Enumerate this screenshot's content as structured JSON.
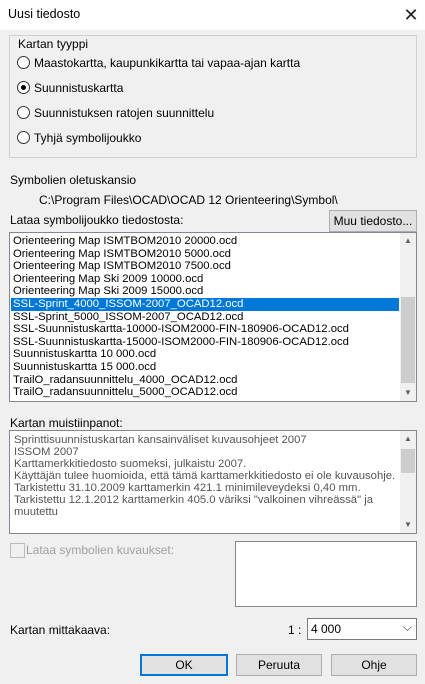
{
  "window": {
    "title": "Uusi tiedosto"
  },
  "map_type": {
    "legend": "Kartan tyyppi",
    "options": [
      {
        "label": "Maastokartta, kaupunkikartta tai vapaa-ajan kartta",
        "selected": false
      },
      {
        "label": "Suunnistuskartta",
        "selected": true
      },
      {
        "label": "Suunnistuksen ratojen suunnittelu",
        "selected": false
      },
      {
        "label": "Tyhjä symbolijoukko",
        "selected": false
      }
    ]
  },
  "symbol_folder": {
    "label": "Symbolien oletuskansio",
    "path": "C:\\Program Files\\OCAD\\OCAD 12 Orienteering\\Symbol\\"
  },
  "load_symbols": {
    "label": "Lataa symbolijoukko tiedostosta:",
    "other_file_button": "Muu tiedosto...",
    "items": [
      "Orienteering Map ISMTBOM2010 20000.ocd",
      "Orienteering Map ISMTBOM2010 5000.ocd",
      "Orienteering Map ISMTBOM2010 7500.ocd",
      "Orienteering Map Ski 2009 10000.ocd",
      "Orienteering Map Ski 2009 15000.ocd",
      "SSL-Sprint_4000_ISSOM-2007_OCAD12.ocd",
      "SSL-Sprint_5000_ISSOM-2007_OCAD12.ocd",
      "SSL-Suunnistuskartta-10000-ISOM2000-FIN-180906-OCAD12.ocd",
      "SSL-Suunnistuskartta-15000-ISOM2000-FIN-180906-OCAD12.ocd",
      "Suunnistuskartta 10 000.ocd",
      "Suunnistuskartta 15 000.ocd",
      "TrailO_radansuunnittelu_4000_OCAD12.ocd",
      "TrailO_radansuunnittelu_5000_OCAD12.ocd"
    ],
    "selected_index": 5
  },
  "notes": {
    "label": "Kartan muistiinpanot:",
    "lines": [
      "Sprinttisuunnistuskartan kansainväliset kuvausohjeet 2007",
      "ISSOM 2007",
      "Karttamerkkitiedosto suomeksi, julkaistu 2007.",
      "Käyttäjän tulee huomioida, että tämä karttamerkkitiedosto ei ole kuvausohje.",
      "Tarkistettu 31.10.2009 karttamerkin 421.1 minimileveydeksi 0,40 mm.",
      "Tarkistettu 12.1.2012 karttamerkin 405.0 väriksi \"valkoinen vihreässä\" ja",
      "muutettu"
    ]
  },
  "load_descriptions": {
    "label": "Lataa symbolien kuvaukset:",
    "checked": false,
    "enabled": false
  },
  "scale": {
    "label": "Kartan mittakaava:",
    "prefix": "1 :",
    "value": "4 000"
  },
  "buttons": {
    "ok": "OK",
    "cancel": "Peruuta",
    "help": "Ohje"
  },
  "colors": {
    "selection": "#0078d7",
    "default_button_border": "#0078d7"
  }
}
